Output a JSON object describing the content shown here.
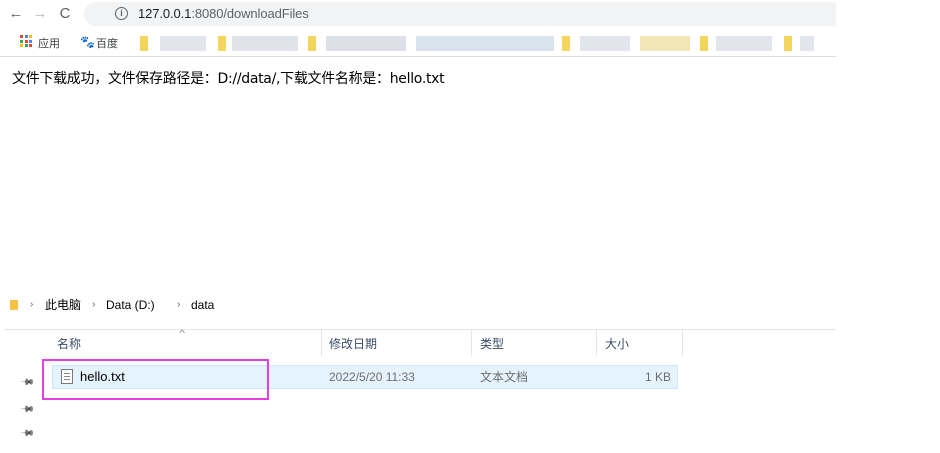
{
  "browser": {
    "nav": {
      "back": "←",
      "forward": "→",
      "reload": "C"
    },
    "info_symbol": "i",
    "url_host": "127.0.0.1",
    "url_path": ":8080/downloadFiles",
    "bookmarks": [
      {
        "label": "应用"
      },
      {
        "label": "百度"
      }
    ],
    "apps_colors": [
      "#ea4335",
      "#4285f4",
      "#fbbc05",
      "#34a853",
      "#ea4335",
      "#4285f4",
      "#fbbc05",
      "#34a853",
      "#ea4335"
    ]
  },
  "page": {
    "message": "文件下载成功，文件保存路径是：D://data/,下载文件名称是：hello.txt"
  },
  "explorer": {
    "breadcrumb": [
      "此电脑",
      "Data (D:)",
      "data"
    ],
    "separator": "›",
    "sort_indicator": "^",
    "columns": {
      "name": "名称",
      "date": "修改日期",
      "type": "类型",
      "size": "大小"
    },
    "files": [
      {
        "name": "hello.txt",
        "date": "2022/5/20 11:33",
        "type": "文本文档",
        "size": "1 KB"
      }
    ],
    "pin_symbol": "📌",
    "colors": {
      "selection": "#e5f3ff",
      "highlight_box": "#e43fe0",
      "folder": "#f5c343"
    }
  }
}
